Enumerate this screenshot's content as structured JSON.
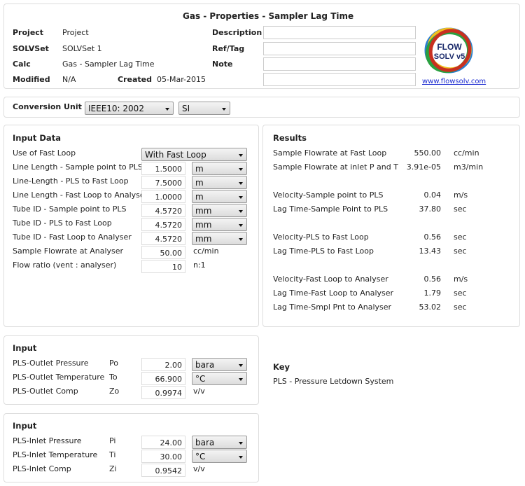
{
  "header": {
    "title": "Gas - Properties - Sampler Lag Time",
    "project_label": "Project",
    "project_value": "Project",
    "solvset_label": "SOLVSet",
    "solvset_value": "SOLVSet 1",
    "calc_label": "Calc",
    "calc_value": "Gas - Sampler Lag Time",
    "modified_label": "Modified",
    "modified_value": "N/A",
    "created_label": "Created",
    "created_value": "05-Mar-2015",
    "description_label": "Description",
    "description_value": "",
    "reftag_label": "Ref/Tag",
    "reftag_value": "",
    "note_label": "Note",
    "note_value": "",
    "extra_value": "",
    "logo_text": "FLOW SOLV v5",
    "link": "www.flowsolv.com"
  },
  "conversion": {
    "label": "Conversion Unit",
    "standard": "IEEE10: 2002",
    "system": "SI"
  },
  "input_data": {
    "title": "Input Data",
    "fast_loop_label": "Use of Fast Loop",
    "fast_loop_value": "With Fast Loop",
    "rows": [
      {
        "label": "Line Length - Sample point to PLS",
        "value": "1.5000",
        "unit": "m"
      },
      {
        "label": "Line-Length - PLS to Fast Loop",
        "value": "7.5000",
        "unit": "m"
      },
      {
        "label": "Line Length - Fast Loop to Analyser",
        "value": "1.0000",
        "unit": "m"
      },
      {
        "label": "Tube ID - Sample point to PLS",
        "value": "4.5720",
        "unit": "mm"
      },
      {
        "label": "Tube ID - PLS to Fast Loop",
        "value": "4.5720",
        "unit": "mm"
      },
      {
        "label": "Tube ID - Fast Loop to Analyser",
        "value": "4.5720",
        "unit": "mm"
      },
      {
        "label": "Sample Flowrate at Analyser",
        "value": "50.00",
        "unit": "cc/min"
      },
      {
        "label": "Flow ratio (vent : analyser)",
        "value": "10",
        "unit": "n:1"
      }
    ]
  },
  "results": {
    "title": "Results",
    "rows": [
      {
        "label": "Sample Flowrate at Fast Loop",
        "value": "550.00",
        "unit": "cc/min"
      },
      {
        "label": "Sample Flowrate at inlet P and T",
        "value": "3.91e-05",
        "unit": "m3/min"
      },
      {
        "label": "Velocity-Sample point to PLS",
        "value": "0.04",
        "unit": "m/s"
      },
      {
        "label": "Lag Time-Sample Point to PLS",
        "value": "37.80",
        "unit": "sec"
      },
      {
        "label": "Velocity-PLS to Fast Loop",
        "value": "0.56",
        "unit": "sec"
      },
      {
        "label": "Lag Time-PLS to Fast Loop",
        "value": "13.43",
        "unit": "sec"
      },
      {
        "label": "Velocity-Fast Loop to Analyser",
        "value": "0.56",
        "unit": "m/s"
      },
      {
        "label": "Lag Time-Fast Loop to Analyser",
        "value": "1.79",
        "unit": "sec"
      },
      {
        "label": "Lag Time-Smpl Pnt to Analyser",
        "value": "53.02",
        "unit": "sec"
      }
    ]
  },
  "outlet": {
    "title": "Input",
    "rows": [
      {
        "label": "PLS-Outlet Pressure",
        "symbol": "Po",
        "value": "2.00",
        "unit": "bara"
      },
      {
        "label": "PLS-Outlet Temperature",
        "symbol": "To",
        "value": "66.900",
        "unit": "°C"
      },
      {
        "label": "PLS-Outlet Comp",
        "symbol": "Zo",
        "value": "0.9974",
        "unit": "v/v"
      }
    ]
  },
  "inlet": {
    "title": "Input",
    "rows": [
      {
        "label": "PLS-Inlet Pressure",
        "symbol": "Pi",
        "value": "24.00",
        "unit": "bara"
      },
      {
        "label": "PLS-Inlet Temperature",
        "symbol": "Ti",
        "value": "30.00",
        "unit": "°C"
      },
      {
        "label": "PLS-Inlet Comp",
        "symbol": "Zi",
        "value": "0.9542",
        "unit": "v/v"
      }
    ]
  },
  "key": {
    "title": "Key",
    "text": "PLS - Pressure Letdown System"
  }
}
